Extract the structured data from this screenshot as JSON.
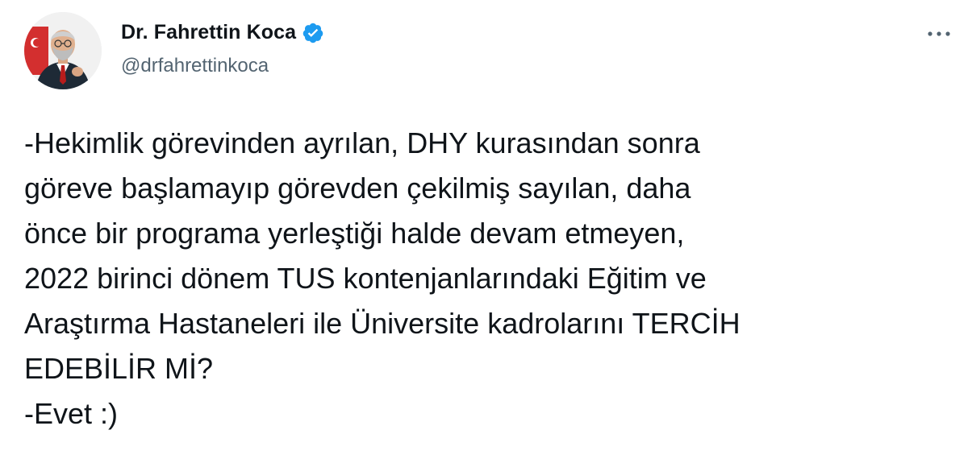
{
  "author": {
    "display_name": "Dr. Fahrettin Koca",
    "handle": "@drfahrettinkoca",
    "verified": true,
    "verified_icon": "verified-badge-icon",
    "verified_color": "#1d9bf0"
  },
  "menu": {
    "icon": "more-horizontal-icon"
  },
  "tweet": {
    "lines": [
      "-Hekimlik görevinden ayrılan, DHY kurasından sonra",
      "göreve başlamayıp görevden çekilmiş sayılan, daha",
      "önce bir programa yerleştiği halde devam etmeyen,",
      "2022 birinci dönem TUS kontenjanlarındaki Eğitim ve",
      "Araştırma Hastaneleri ile Üniversite kadrolarını TERCİH",
      "EDEBİLİR Mİ?",
      "-Evet :)"
    ]
  },
  "colors": {
    "text": "#0f1419",
    "secondary": "#536471",
    "accent": "#1d9bf0",
    "background": "#ffffff"
  }
}
